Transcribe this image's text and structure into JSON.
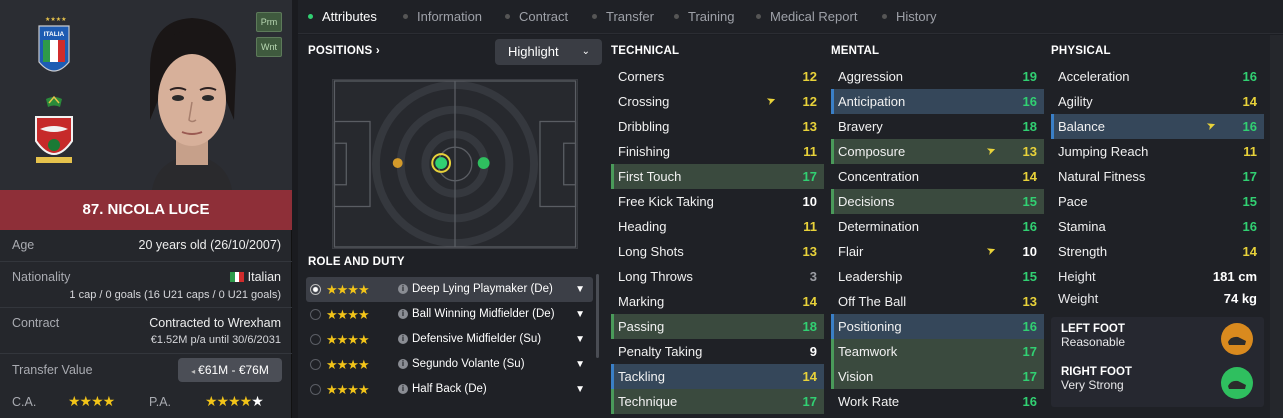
{
  "player": {
    "name": "87. NICOLA LUCE",
    "tags": [
      "Prm",
      "Wnt"
    ],
    "age_label": "Age",
    "age": "20 years old (26/10/2007)",
    "nationality_label": "Nationality",
    "nationality": "Italian",
    "caps": "1 cap / 0 goals (16 U21 caps / 0 U21 goals)",
    "contract_label": "Contract",
    "contract": "Contracted to Wrexham",
    "wage": "€1.52M p/a until 30/6/2031",
    "tv_label": "Transfer Value",
    "tv": "€61M - €76M",
    "ca_label": "C.A.",
    "pa_label": "P.A.",
    "ca_stars": "★★★★",
    "pa_stars": "★★★★",
    "pa_white": "★",
    "emblem_text": "ITALIA"
  },
  "tabs": [
    "Attributes",
    "Information",
    "Contract",
    "Transfer",
    "Training",
    "Medical Report",
    "History"
  ],
  "positions": {
    "header": "POSITIONS ›",
    "highlight": "Highlight"
  },
  "roles": {
    "header": "ROLE AND DUTY",
    "items": [
      {
        "stars": "★★★★",
        "name": "Deep Lying Playmaker (De)"
      },
      {
        "stars": "★★★★",
        "name": "Ball Winning Midfielder (De)"
      },
      {
        "stars": "★★★★",
        "name": "Defensive Midfielder (Su)"
      },
      {
        "stars": "★★★★",
        "name": "Segundo Volante (Su)"
      },
      {
        "stars": "★★★★",
        "name": "Half Back (De)"
      }
    ]
  },
  "technical": {
    "header": "TECHNICAL",
    "items": [
      {
        "n": "Corners",
        "v": "12"
      },
      {
        "n": "Crossing",
        "v": "12"
      },
      {
        "n": "Dribbling",
        "v": "13"
      },
      {
        "n": "Finishing",
        "v": "11"
      },
      {
        "n": "First Touch",
        "v": "17"
      },
      {
        "n": "Free Kick Taking",
        "v": "10"
      },
      {
        "n": "Heading",
        "v": "11"
      },
      {
        "n": "Long Shots",
        "v": "13"
      },
      {
        "n": "Long Throws",
        "v": "3"
      },
      {
        "n": "Marking",
        "v": "14"
      },
      {
        "n": "Passing",
        "v": "18"
      },
      {
        "n": "Penalty Taking",
        "v": "9"
      },
      {
        "n": "Tackling",
        "v": "14"
      },
      {
        "n": "Technique",
        "v": "17"
      }
    ]
  },
  "mental": {
    "header": "MENTAL",
    "items": [
      {
        "n": "Aggression",
        "v": "19"
      },
      {
        "n": "Anticipation",
        "v": "16"
      },
      {
        "n": "Bravery",
        "v": "18"
      },
      {
        "n": "Composure",
        "v": "13"
      },
      {
        "n": "Concentration",
        "v": "14"
      },
      {
        "n": "Decisions",
        "v": "15"
      },
      {
        "n": "Determination",
        "v": "16"
      },
      {
        "n": "Flair",
        "v": "10"
      },
      {
        "n": "Leadership",
        "v": "15"
      },
      {
        "n": "Off The Ball",
        "v": "13"
      },
      {
        "n": "Positioning",
        "v": "16"
      },
      {
        "n": "Teamwork",
        "v": "17"
      },
      {
        "n": "Vision",
        "v": "17"
      },
      {
        "n": "Work Rate",
        "v": "16"
      }
    ]
  },
  "physical": {
    "header": "PHYSICAL",
    "items": [
      {
        "n": "Acceleration",
        "v": "16"
      },
      {
        "n": "Agility",
        "v": "14"
      },
      {
        "n": "Balance",
        "v": "16"
      },
      {
        "n": "Jumping Reach",
        "v": "11"
      },
      {
        "n": "Natural Fitness",
        "v": "17"
      },
      {
        "n": "Pace",
        "v": "15"
      },
      {
        "n": "Stamina",
        "v": "16"
      },
      {
        "n": "Strength",
        "v": "14"
      }
    ],
    "height_label": "Height",
    "height": "181 cm",
    "weight_label": "Weight",
    "weight": "74 kg"
  },
  "feet": {
    "left_label": "LEFT FOOT",
    "left": "Reasonable",
    "right_label": "RIGHT FOOT",
    "right": "Very Strong"
  },
  "colors": {
    "green": "#31d072",
    "yellow": "#e8d23a",
    "orange": "#e0a64c",
    "name_bar": "#8e2f38"
  }
}
